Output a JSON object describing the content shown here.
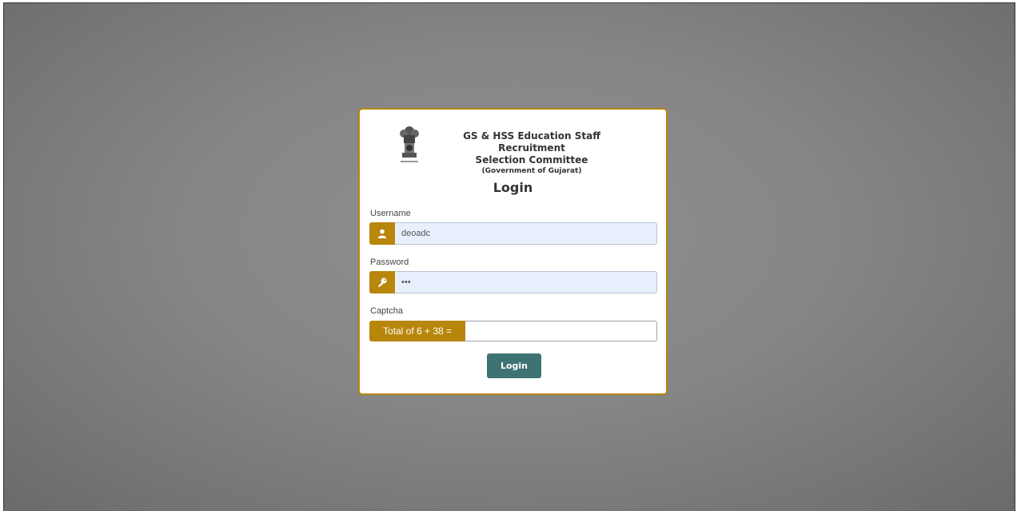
{
  "header": {
    "org_line1": "GS & HSS Education Staff Recruitment",
    "org_line2": "Selection Committee",
    "org_line3": "(Government of Gujarat)"
  },
  "login": {
    "heading": "Login",
    "username_label": "Username",
    "username_value": "deoadc",
    "password_label": "Password",
    "password_value": "abc",
    "captcha_label": "Captcha",
    "captcha_prompt": "Total of 6 + 38 =",
    "captcha_value": "",
    "submit_label": "Login"
  },
  "icons": {
    "username": "user-icon",
    "password": "key-icon",
    "emblem": "state-emblem-icon"
  },
  "colors": {
    "accent": "#b8860b",
    "button": "#3f7373",
    "input_fill": "#e8f0fe"
  }
}
